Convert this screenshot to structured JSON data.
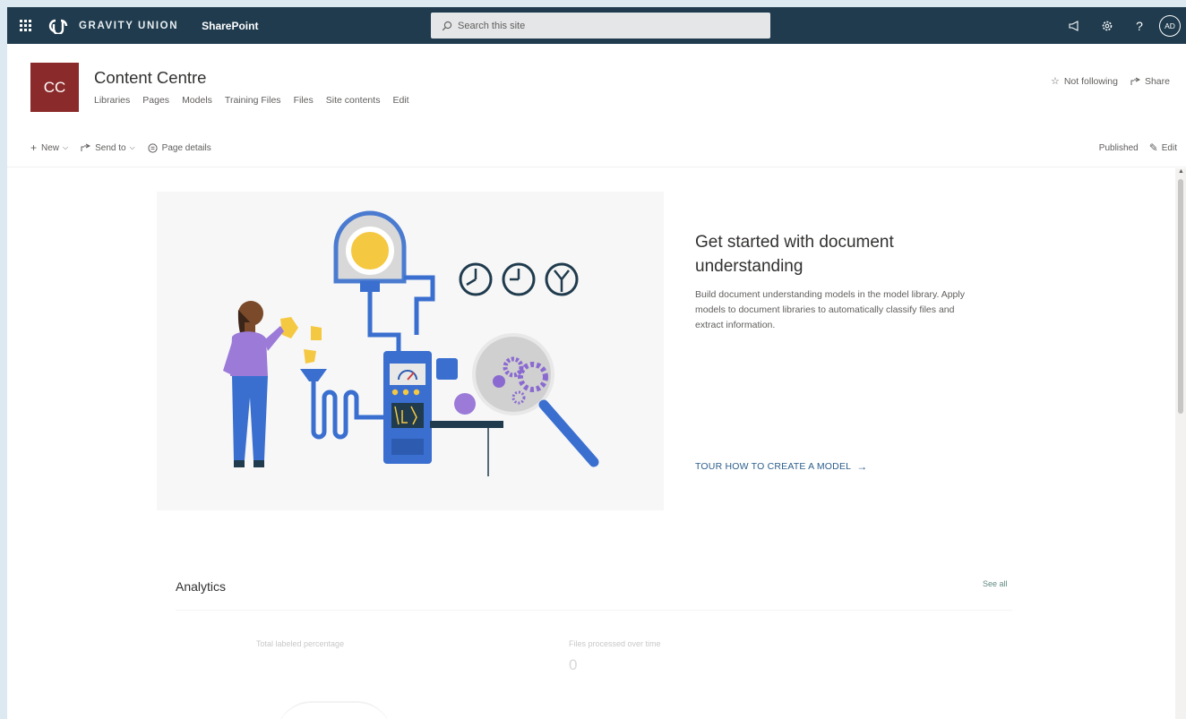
{
  "suite": {
    "brand": "GRAVITY UNION",
    "app": "SharePoint",
    "search_placeholder": "Search this site",
    "icons": [
      "megaphone-icon",
      "gear-icon",
      "help-icon"
    ],
    "user_initials": "AD"
  },
  "site": {
    "logo_initials": "CC",
    "title": "Content Centre",
    "nav": [
      "Libraries",
      "Pages",
      "Models",
      "Training Files",
      "Files",
      "Site contents",
      "Edit"
    ],
    "follow_label": "Not following",
    "share_label": "Share"
  },
  "commandbar": {
    "new_label": "New",
    "send_label": "Send to",
    "details_label": "Page details",
    "status": "Published",
    "edit_label": "Edit"
  },
  "hero": {
    "title": "Get started with document understanding",
    "description": "Build document understanding models in the model library. Apply models to document libraries to automatically classify files and extract information.",
    "link": "TOUR HOW TO CREATE A MODEL"
  },
  "analytics": {
    "title": "Analytics",
    "see_all": "See all",
    "metrics": [
      {
        "label": "Total labeled percentage",
        "value": ""
      },
      {
        "label": "Files processed over time",
        "value": "0"
      }
    ]
  },
  "colors": {
    "suitebar": "#1f3b4d",
    "site_logo": "#8b2a2a",
    "link": "#2c5f8d",
    "page_border": "#dce9f1"
  }
}
